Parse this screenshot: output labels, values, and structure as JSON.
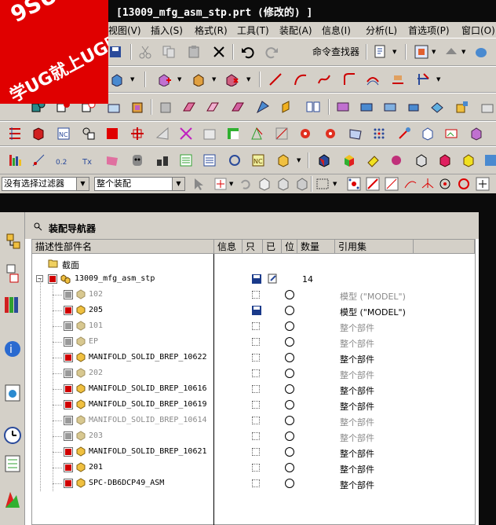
{
  "window": {
    "title": "[13009_mfg_asm_stp.prt  (修改的)  ]"
  },
  "watermark": {
    "line1": "9SUG",
    "line2": "学UG就上UG网"
  },
  "menu": {
    "items": [
      "视图(V)",
      "插入(S)",
      "格式(R)",
      "工具(T)",
      "装配(A)",
      "信息(I)",
      "分析(L)",
      "首选项(P)",
      "窗口(O)"
    ]
  },
  "toolbar": {
    "command_finder": "命令查找器"
  },
  "selection": {
    "filter_value": "没有选择过滤器",
    "scope_value": "整个装配"
  },
  "navigator": {
    "title": "装配导航器",
    "columns": {
      "name": "描述性部件名",
      "info": "信息",
      "readonly": "只",
      "modified": "已",
      "position": "位",
      "quantity": "数量",
      "refset": "引用集"
    },
    "section_label": "截面",
    "root": {
      "name": "13009_mfg_asm_stp",
      "quantity": "14"
    },
    "children": [
      {
        "name": "102",
        "refset": "模型 (\"MODEL\")",
        "active": false,
        "saved": false
      },
      {
        "name": "205",
        "refset": "模型 (\"MODEL\")",
        "active": true,
        "saved": true
      },
      {
        "name": "101",
        "refset": "整个部件",
        "active": false,
        "saved": false
      },
      {
        "name": "EP",
        "refset": "整个部件",
        "active": false,
        "saved": false
      },
      {
        "name": "MANIFOLD_SOLID_BREP_10622",
        "refset": "整个部件",
        "active": true,
        "saved": false
      },
      {
        "name": "202",
        "refset": "整个部件",
        "active": false,
        "saved": false
      },
      {
        "name": "MANIFOLD_SOLID_BREP_10616",
        "refset": "整个部件",
        "active": true,
        "saved": false
      },
      {
        "name": "MANIFOLD_SOLID_BREP_10619",
        "refset": "整个部件",
        "active": true,
        "saved": false
      },
      {
        "name": "MANIFOLD_SOLID_BREP_10614",
        "refset": "整个部件",
        "active": false,
        "saved": false
      },
      {
        "name": "203",
        "refset": "整个部件",
        "active": false,
        "saved": false
      },
      {
        "name": "MANIFOLD_SOLID_BREP_10621",
        "refset": "整个部件",
        "active": true,
        "saved": false
      },
      {
        "name": "201",
        "refset": "整个部件",
        "active": true,
        "saved": false
      },
      {
        "name": "SPC-DB6DCP49_ASM",
        "refset": "整个部件",
        "active": true,
        "saved": false
      }
    ]
  }
}
